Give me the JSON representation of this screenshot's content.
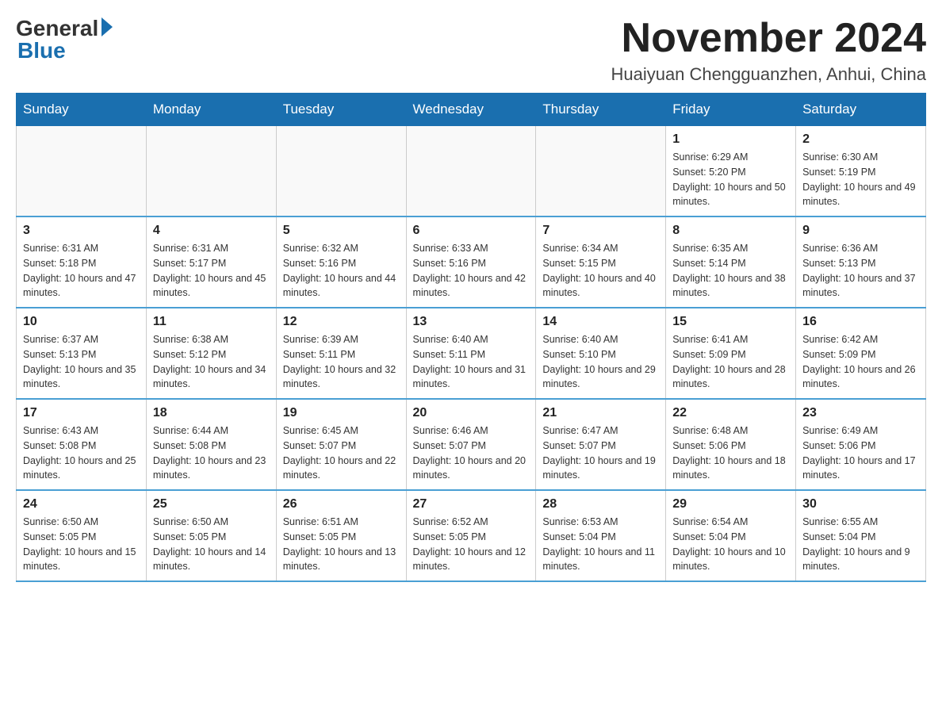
{
  "header": {
    "logo_general": "General",
    "logo_blue": "Blue",
    "month_title": "November 2024",
    "location": "Huaiyuan Chengguanzhen, Anhui, China"
  },
  "days_of_week": [
    "Sunday",
    "Monday",
    "Tuesday",
    "Wednesday",
    "Thursday",
    "Friday",
    "Saturday"
  ],
  "weeks": [
    [
      {
        "day": "",
        "sunrise": "",
        "sunset": "",
        "daylight": ""
      },
      {
        "day": "",
        "sunrise": "",
        "sunset": "",
        "daylight": ""
      },
      {
        "day": "",
        "sunrise": "",
        "sunset": "",
        "daylight": ""
      },
      {
        "day": "",
        "sunrise": "",
        "sunset": "",
        "daylight": ""
      },
      {
        "day": "",
        "sunrise": "",
        "sunset": "",
        "daylight": ""
      },
      {
        "day": "1",
        "sunrise": "Sunrise: 6:29 AM",
        "sunset": "Sunset: 5:20 PM",
        "daylight": "Daylight: 10 hours and 50 minutes."
      },
      {
        "day": "2",
        "sunrise": "Sunrise: 6:30 AM",
        "sunset": "Sunset: 5:19 PM",
        "daylight": "Daylight: 10 hours and 49 minutes."
      }
    ],
    [
      {
        "day": "3",
        "sunrise": "Sunrise: 6:31 AM",
        "sunset": "Sunset: 5:18 PM",
        "daylight": "Daylight: 10 hours and 47 minutes."
      },
      {
        "day": "4",
        "sunrise": "Sunrise: 6:31 AM",
        "sunset": "Sunset: 5:17 PM",
        "daylight": "Daylight: 10 hours and 45 minutes."
      },
      {
        "day": "5",
        "sunrise": "Sunrise: 6:32 AM",
        "sunset": "Sunset: 5:16 PM",
        "daylight": "Daylight: 10 hours and 44 minutes."
      },
      {
        "day": "6",
        "sunrise": "Sunrise: 6:33 AM",
        "sunset": "Sunset: 5:16 PM",
        "daylight": "Daylight: 10 hours and 42 minutes."
      },
      {
        "day": "7",
        "sunrise": "Sunrise: 6:34 AM",
        "sunset": "Sunset: 5:15 PM",
        "daylight": "Daylight: 10 hours and 40 minutes."
      },
      {
        "day": "8",
        "sunrise": "Sunrise: 6:35 AM",
        "sunset": "Sunset: 5:14 PM",
        "daylight": "Daylight: 10 hours and 38 minutes."
      },
      {
        "day": "9",
        "sunrise": "Sunrise: 6:36 AM",
        "sunset": "Sunset: 5:13 PM",
        "daylight": "Daylight: 10 hours and 37 minutes."
      }
    ],
    [
      {
        "day": "10",
        "sunrise": "Sunrise: 6:37 AM",
        "sunset": "Sunset: 5:13 PM",
        "daylight": "Daylight: 10 hours and 35 minutes."
      },
      {
        "day": "11",
        "sunrise": "Sunrise: 6:38 AM",
        "sunset": "Sunset: 5:12 PM",
        "daylight": "Daylight: 10 hours and 34 minutes."
      },
      {
        "day": "12",
        "sunrise": "Sunrise: 6:39 AM",
        "sunset": "Sunset: 5:11 PM",
        "daylight": "Daylight: 10 hours and 32 minutes."
      },
      {
        "day": "13",
        "sunrise": "Sunrise: 6:40 AM",
        "sunset": "Sunset: 5:11 PM",
        "daylight": "Daylight: 10 hours and 31 minutes."
      },
      {
        "day": "14",
        "sunrise": "Sunrise: 6:40 AM",
        "sunset": "Sunset: 5:10 PM",
        "daylight": "Daylight: 10 hours and 29 minutes."
      },
      {
        "day": "15",
        "sunrise": "Sunrise: 6:41 AM",
        "sunset": "Sunset: 5:09 PM",
        "daylight": "Daylight: 10 hours and 28 minutes."
      },
      {
        "day": "16",
        "sunrise": "Sunrise: 6:42 AM",
        "sunset": "Sunset: 5:09 PM",
        "daylight": "Daylight: 10 hours and 26 minutes."
      }
    ],
    [
      {
        "day": "17",
        "sunrise": "Sunrise: 6:43 AM",
        "sunset": "Sunset: 5:08 PM",
        "daylight": "Daylight: 10 hours and 25 minutes."
      },
      {
        "day": "18",
        "sunrise": "Sunrise: 6:44 AM",
        "sunset": "Sunset: 5:08 PM",
        "daylight": "Daylight: 10 hours and 23 minutes."
      },
      {
        "day": "19",
        "sunrise": "Sunrise: 6:45 AM",
        "sunset": "Sunset: 5:07 PM",
        "daylight": "Daylight: 10 hours and 22 minutes."
      },
      {
        "day": "20",
        "sunrise": "Sunrise: 6:46 AM",
        "sunset": "Sunset: 5:07 PM",
        "daylight": "Daylight: 10 hours and 20 minutes."
      },
      {
        "day": "21",
        "sunrise": "Sunrise: 6:47 AM",
        "sunset": "Sunset: 5:07 PM",
        "daylight": "Daylight: 10 hours and 19 minutes."
      },
      {
        "day": "22",
        "sunrise": "Sunrise: 6:48 AM",
        "sunset": "Sunset: 5:06 PM",
        "daylight": "Daylight: 10 hours and 18 minutes."
      },
      {
        "day": "23",
        "sunrise": "Sunrise: 6:49 AM",
        "sunset": "Sunset: 5:06 PM",
        "daylight": "Daylight: 10 hours and 17 minutes."
      }
    ],
    [
      {
        "day": "24",
        "sunrise": "Sunrise: 6:50 AM",
        "sunset": "Sunset: 5:05 PM",
        "daylight": "Daylight: 10 hours and 15 minutes."
      },
      {
        "day": "25",
        "sunrise": "Sunrise: 6:50 AM",
        "sunset": "Sunset: 5:05 PM",
        "daylight": "Daylight: 10 hours and 14 minutes."
      },
      {
        "day": "26",
        "sunrise": "Sunrise: 6:51 AM",
        "sunset": "Sunset: 5:05 PM",
        "daylight": "Daylight: 10 hours and 13 minutes."
      },
      {
        "day": "27",
        "sunrise": "Sunrise: 6:52 AM",
        "sunset": "Sunset: 5:05 PM",
        "daylight": "Daylight: 10 hours and 12 minutes."
      },
      {
        "day": "28",
        "sunrise": "Sunrise: 6:53 AM",
        "sunset": "Sunset: 5:04 PM",
        "daylight": "Daylight: 10 hours and 11 minutes."
      },
      {
        "day": "29",
        "sunrise": "Sunrise: 6:54 AM",
        "sunset": "Sunset: 5:04 PM",
        "daylight": "Daylight: 10 hours and 10 minutes."
      },
      {
        "day": "30",
        "sunrise": "Sunrise: 6:55 AM",
        "sunset": "Sunset: 5:04 PM",
        "daylight": "Daylight: 10 hours and 9 minutes."
      }
    ]
  ]
}
